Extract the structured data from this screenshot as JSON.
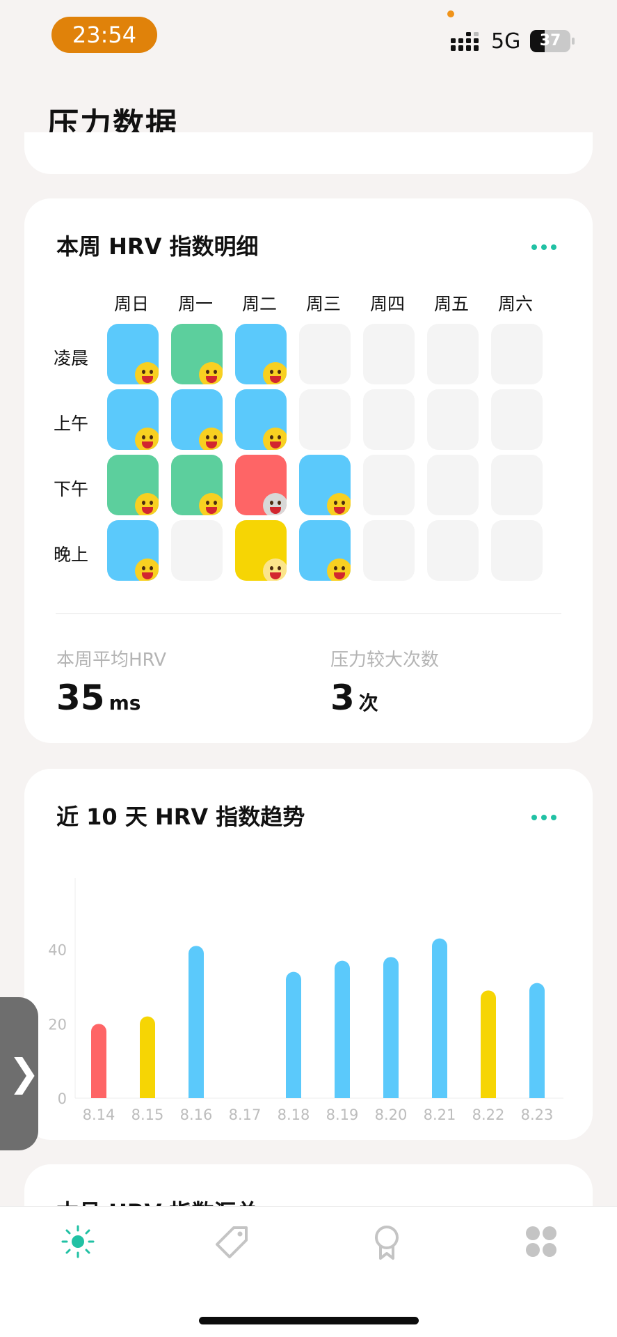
{
  "status_bar": {
    "time": "23:54",
    "network": "5G",
    "battery": "37",
    "battery_fraction": 0.37
  },
  "page": {
    "title": "压力数据"
  },
  "weekly_card": {
    "title": "本周 HRV 指数明细",
    "more_icon": "more-dots-icon",
    "days": [
      "周日",
      "周一",
      "周二",
      "周三",
      "周四",
      "周五",
      "周六"
    ],
    "periods": [
      "凌晨",
      "上午",
      "下午",
      "晚上"
    ],
    "level_colors": {
      "blue": "#5bc9fb",
      "green": "#5ccf9d",
      "red": "#fe6566",
      "yellow": "#f6d504",
      "empty": "#f4f4f4"
    },
    "grid": [
      [
        "blue",
        "green",
        "blue",
        "empty",
        "empty",
        "empty",
        "empty"
      ],
      [
        "blue",
        "blue",
        "blue",
        "empty",
        "empty",
        "empty",
        "empty"
      ],
      [
        "green",
        "green",
        "red",
        "blue",
        "empty",
        "empty",
        "empty"
      ],
      [
        "blue",
        "empty",
        "yellow",
        "blue",
        "empty",
        "empty",
        "empty"
      ]
    ],
    "stats": [
      {
        "label": "本周平均HRV",
        "value": "35",
        "unit": "ms"
      },
      {
        "label": "压力较大次数",
        "value": "3",
        "unit": "次"
      }
    ]
  },
  "trend_card": {
    "title": "近 10 天 HRV 指数趋势",
    "more_icon": "more-dots-icon"
  },
  "chart_data": {
    "type": "bar",
    "categories": [
      "8.14",
      "8.15",
      "8.16",
      "8.17",
      "8.18",
      "8.19",
      "8.20",
      "8.21",
      "8.22",
      "8.23"
    ],
    "values": [
      20,
      22,
      41,
      null,
      34,
      37,
      38,
      43,
      29,
      31
    ],
    "bar_colors": [
      "#fe6566",
      "#f6d504",
      "#5bc9fb",
      null,
      "#5bc9fb",
      "#5bc9fb",
      "#5bc9fb",
      "#5bc9fb",
      "#f6d504",
      "#5bc9fb"
    ],
    "yticks": [
      "0",
      "20",
      "40"
    ],
    "ylim": [
      0,
      48
    ],
    "grid": false
  },
  "summary_card": {
    "title_partial": "本月 HRV 指数汇总"
  },
  "side_handle": {
    "label": "❯"
  },
  "tabbar": {
    "active_color": "#21c1a4",
    "inactive_color": "#c4c4c4",
    "tabs": [
      {
        "icon": "sun-icon",
        "active": true
      },
      {
        "icon": "tag-icon",
        "active": false
      },
      {
        "icon": "award-icon",
        "active": false
      },
      {
        "icon": "grid-icon",
        "active": false
      }
    ]
  }
}
